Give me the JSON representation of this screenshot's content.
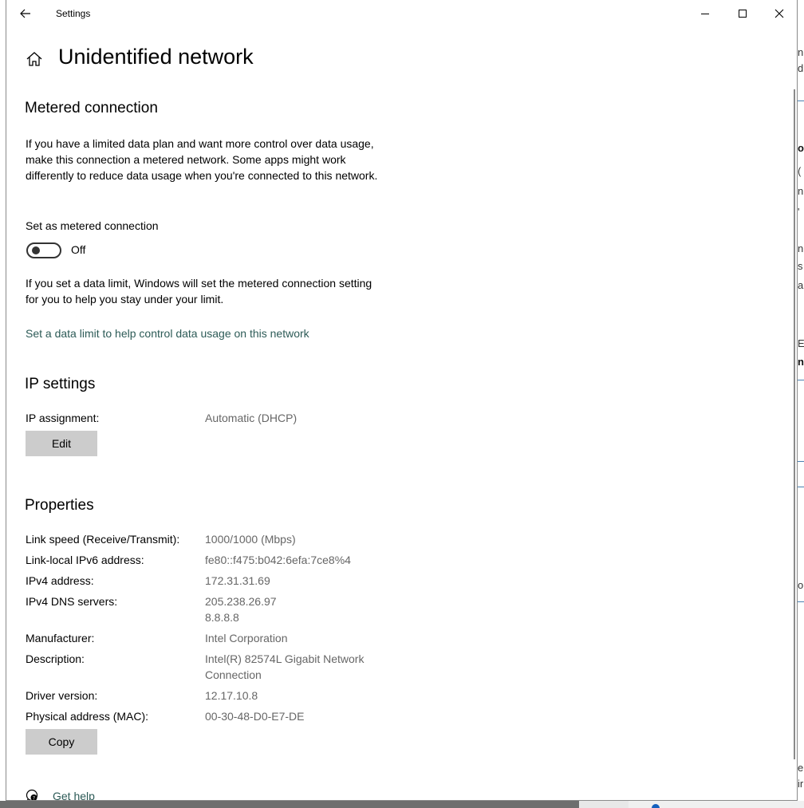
{
  "window": {
    "title": "Settings"
  },
  "page": {
    "title": "Unidentified network"
  },
  "metered": {
    "heading": "Metered connection",
    "description": "If you have a limited data plan and want more control over data usage, make this connection a metered network. Some apps might work differently to reduce data usage when you're connected to this network.",
    "toggle_label": "Set as metered connection",
    "toggle_state": "Off",
    "toggle_on": false,
    "limit_note": "If you set a data limit, Windows will set the metered connection setting for you to help you stay under your limit.",
    "limit_link": "Set a data limit to help control data usage on this network"
  },
  "ip_settings": {
    "heading": "IP settings",
    "assignment_label": "IP assignment:",
    "assignment_value": "Automatic (DHCP)",
    "edit_label": "Edit"
  },
  "properties": {
    "heading": "Properties",
    "rows": [
      {
        "key": "Link speed (Receive/Transmit):",
        "value": "1000/1000 (Mbps)"
      },
      {
        "key": "Link-local IPv6 address:",
        "value": "fe80::f475:b042:6efa:7ce8%4"
      },
      {
        "key": "IPv4 address:",
        "value": "172.31.31.69"
      },
      {
        "key": "IPv4 DNS servers:",
        "value": "205.238.26.97",
        "value2": "8.8.8.8"
      },
      {
        "key": "Manufacturer:",
        "value": "Intel Corporation"
      },
      {
        "key": "Description:",
        "value": "Intel(R) 82574L Gigabit Network",
        "value2": "Connection"
      },
      {
        "key": "Driver version:",
        "value": "12.17.10.8"
      },
      {
        "key": "Physical address (MAC):",
        "value": "00-30-48-D0-E7-DE"
      }
    ],
    "copy_label": "Copy"
  },
  "help": {
    "label": "Get help"
  },
  "background_window": {
    "fragments": [
      "n",
      "d",
      "o",
      "(",
      "n",
      "'",
      "n",
      "s",
      "a",
      "E",
      "n",
      "o",
      "e",
      "ir"
    ]
  },
  "icons": {
    "back": "back-arrow-icon",
    "home": "home-icon",
    "minimize": "minimize-icon",
    "maximize": "maximize-icon",
    "close": "close-icon",
    "help": "help-chat-icon"
  }
}
